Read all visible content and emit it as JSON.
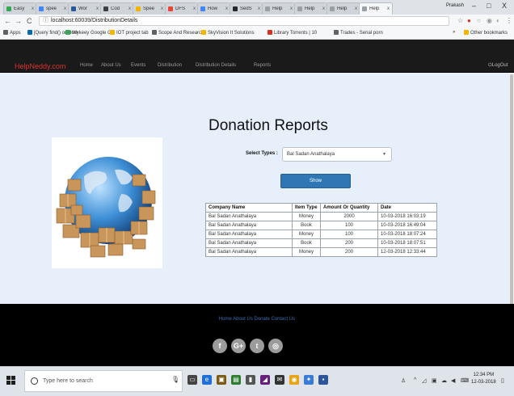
{
  "browser": {
    "tabs": [
      {
        "label": "Easy",
        "color": "#34a853"
      },
      {
        "label": "spee",
        "color": "#4285f4"
      },
      {
        "label": "Wor",
        "color": "#2b579a"
      },
      {
        "label": "Cod",
        "color": "#3c4043"
      },
      {
        "label": "Spee",
        "color": "#f4b400"
      },
      {
        "label": "DFS",
        "color": "#ea4335"
      },
      {
        "label": "How",
        "color": "#4285f4"
      },
      {
        "label": "SedS",
        "color": "#24292e"
      },
      {
        "label": "Help",
        "color": "#9aa0a6"
      },
      {
        "label": "Help",
        "color": "#9aa0a6"
      },
      {
        "label": "Help",
        "color": "#9aa0a6"
      },
      {
        "label": "Help",
        "color": "#9aa0a6"
      }
    ],
    "tab_close": "x",
    "profile": "Prakash",
    "window_minimize": "–",
    "window_maximize": "□",
    "window_close": "X",
    "back": "←",
    "forward": "→",
    "reload": "C",
    "url": "localhost:60039/DistributionDetails",
    "bookmarks": [
      {
        "label": "Apps",
        "color": "#5f6368"
      },
      {
        "label": "jQuery find() on dom",
        "color": "#0769ad"
      },
      {
        "label": "Wykeey Google Gu",
        "color": "#34a853"
      },
      {
        "label": "IOT project tab",
        "color": "#f4b400"
      },
      {
        "label": "Scope And Research",
        "color": "#5f6368"
      },
      {
        "label": "SkyVision It Solutions",
        "color": "#f4b400"
      },
      {
        "label": "Library Torrents | 10",
        "color": "#d93025"
      },
      {
        "label": "Trades - Serial porn",
        "color": "#5f6368"
      }
    ],
    "bookmarks_more": "»",
    "other_bookmarks": "Other bookmarks"
  },
  "site": {
    "brand": "HelpNeddy.com",
    "nav": [
      "Home",
      "About Us",
      "Events",
      "Distribution",
      "Distribution Details",
      "Reports"
    ],
    "logout": "LogOut"
  },
  "main": {
    "title": "Donation Reports",
    "select_label": "Select Types :",
    "select_value": "Bal Sadan Anathalaya",
    "show_button": "Show",
    "table": {
      "headers": [
        "Company Name",
        "Item Type",
        "Amount Or Quantity",
        "Date"
      ],
      "rows": [
        [
          "Bal Sadan Anathalaya",
          "Money",
          "2000",
          "10-03-2018 16:03:19"
        ],
        [
          "Bal Sadan Anathalaya",
          "Book",
          "100",
          "10-03-2018 16:49:04"
        ],
        [
          "Bal Sadan Anathalaya",
          "Money",
          "100",
          "10-03-2018 18:07:24"
        ],
        [
          "Bal Sadan Anathalaya",
          "Book",
          "200",
          "10-03-2018 18:07:51"
        ],
        [
          "Bal Sadan Anathalaya",
          "Money",
          "200",
          "12-03-2018 12:33:44"
        ]
      ]
    }
  },
  "footer": {
    "links": "Home About Us Donate Contact Us",
    "socials": [
      {
        "name": "facebook",
        "glyph": "f"
      },
      {
        "name": "google-plus",
        "glyph": "G+"
      },
      {
        "name": "twitter",
        "glyph": "t"
      },
      {
        "name": "instagram",
        "glyph": "◎"
      }
    ]
  },
  "taskbar": {
    "search_placeholder": "Type here to search",
    "time": "12:34 PM",
    "date": "12-03-2018"
  },
  "colors": {
    "brand_red": "#e03030",
    "nav_bg": "#1a1a1a",
    "content_bg": "#e7f0fa",
    "button_blue": "#2f77b4",
    "footer_link": "#3a6fb0"
  }
}
